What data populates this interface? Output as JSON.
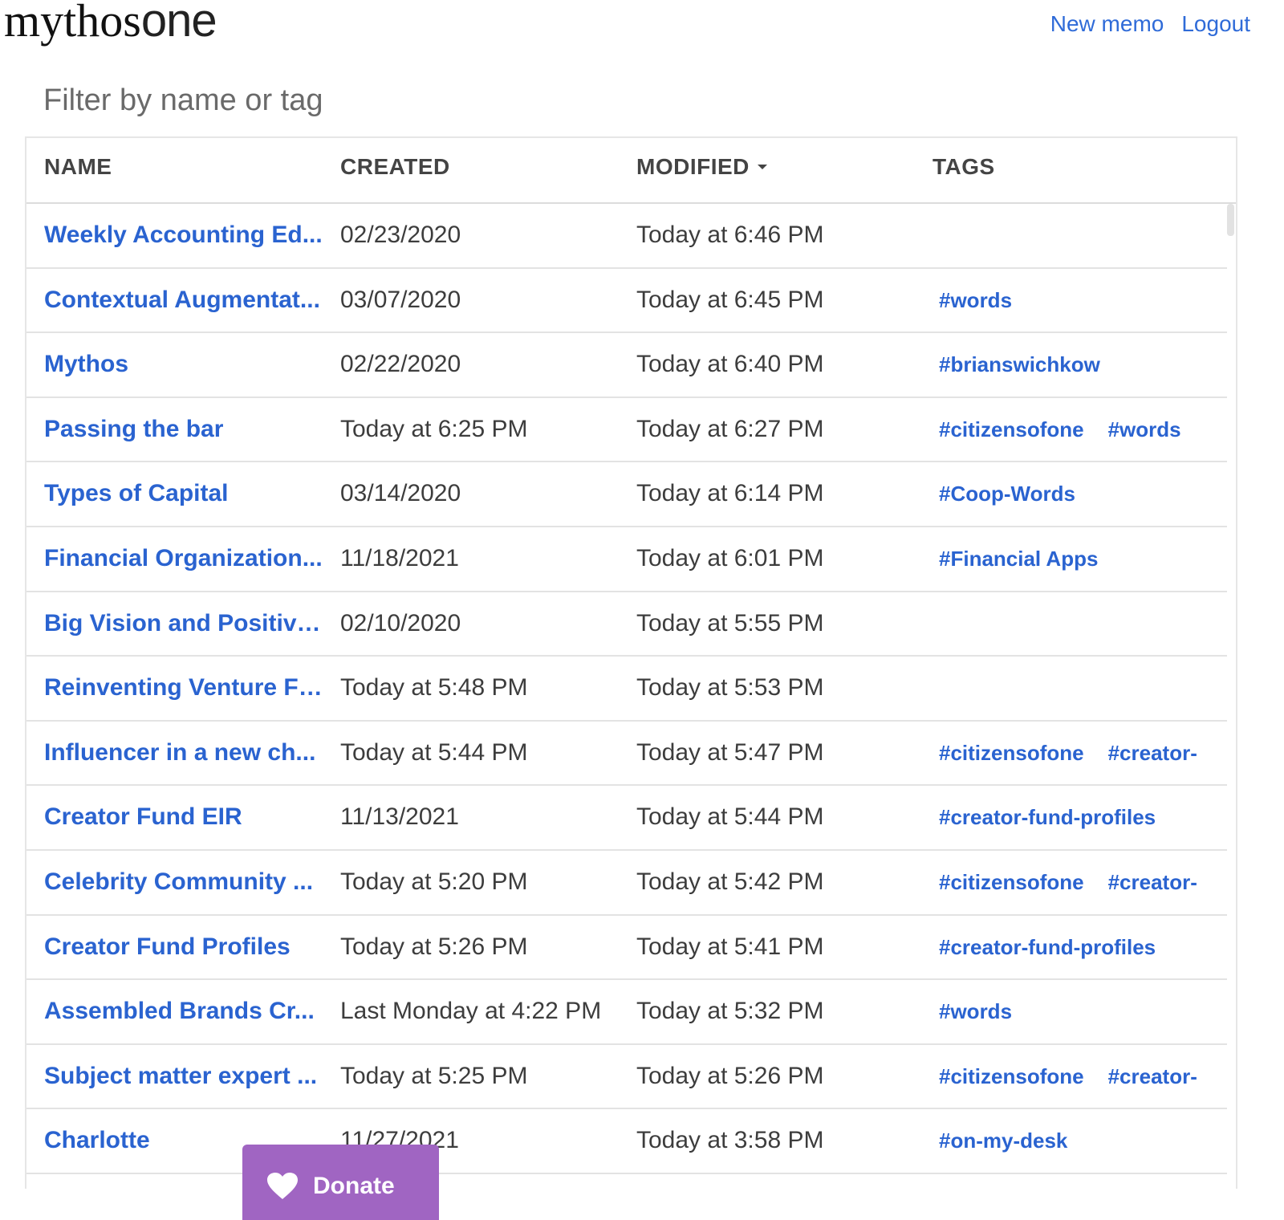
{
  "header": {
    "logo_main": "mythos",
    "logo_sub": "one",
    "nav": {
      "new_memo": "New memo",
      "logout": "Logout"
    }
  },
  "filter": {
    "placeholder": "Filter by name or tag"
  },
  "table": {
    "columns": {
      "name": "NAME",
      "created": "CREATED",
      "modified": "MODIFIED",
      "tags": "TAGS"
    },
    "sort": {
      "column": "modified",
      "direction": "desc"
    },
    "rows": [
      {
        "name": "Weekly Accounting Ed...",
        "created": "02/23/2020",
        "modified": "Today at 6:46 PM",
        "tags": []
      },
      {
        "name": "Contextual Augmentat...",
        "created": "03/07/2020",
        "modified": "Today at 6:45 PM",
        "tags": [
          "#words"
        ]
      },
      {
        "name": "Mythos",
        "created": "02/22/2020",
        "modified": "Today at 6:40 PM",
        "tags": [
          "#brianswichkow"
        ]
      },
      {
        "name": "Passing the bar",
        "created": "Today at 6:25 PM",
        "modified": "Today at 6:27 PM",
        "tags": [
          "#citizensofone",
          "#words"
        ]
      },
      {
        "name": "Types of Capital",
        "created": "03/14/2020",
        "modified": "Today at 6:14 PM",
        "tags": [
          "#Coop-Words"
        ]
      },
      {
        "name": "Financial Organization...",
        "created": "11/18/2021",
        "modified": "Today at 6:01 PM",
        "tags": [
          "#Financial Apps"
        ]
      },
      {
        "name": "Big Vision and Positive...",
        "created": "02/10/2020",
        "modified": "Today at 5:55 PM",
        "tags": []
      },
      {
        "name": "Reinventing Venture Fi...",
        "created": "Today at 5:48 PM",
        "modified": "Today at 5:53 PM",
        "tags": []
      },
      {
        "name": "Influencer in a new ch...",
        "created": "Today at 5:44 PM",
        "modified": "Today at 5:47 PM",
        "tags": [
          "#citizensofone",
          "#creator-"
        ]
      },
      {
        "name": "Creator Fund EIR",
        "created": "11/13/2021",
        "modified": "Today at 5:44 PM",
        "tags": [
          "#creator-fund-profiles"
        ]
      },
      {
        "name": "Celebrity Community ...",
        "created": "Today at 5:20 PM",
        "modified": "Today at 5:42 PM",
        "tags": [
          "#citizensofone",
          "#creator-"
        ]
      },
      {
        "name": "Creator Fund Profiles",
        "created": "Today at 5:26 PM",
        "modified": "Today at 5:41 PM",
        "tags": [
          "#creator-fund-profiles"
        ]
      },
      {
        "name": "Assembled Brands Cr...",
        "created": "Last Monday at 4:22 PM",
        "modified": "Today at 5:32 PM",
        "tags": [
          "#words"
        ]
      },
      {
        "name": "Subject matter expert ...",
        "created": "Today at 5:25 PM",
        "modified": "Today at 5:26 PM",
        "tags": [
          "#citizensofone",
          "#creator-"
        ]
      },
      {
        "name": "Charlotte",
        "created": "11/27/2021",
        "modified": "Today at 3:58 PM",
        "tags": [
          "#on-my-desk"
        ]
      }
    ]
  },
  "donate": {
    "label": "Donate",
    "icon": "heart-icon",
    "color": "#a065c2"
  },
  "colors": {
    "link": "#2a63d0",
    "text": "#3d3d3d",
    "border": "#e3e3e3"
  }
}
